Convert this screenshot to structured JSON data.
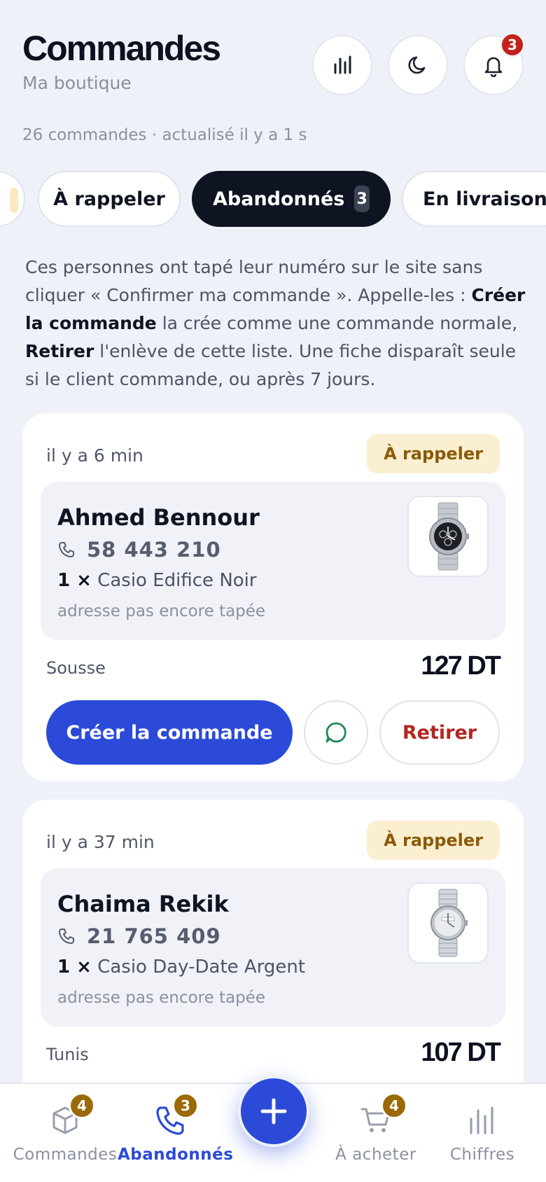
{
  "header": {
    "title": "Commandes",
    "subtitle": "Ma boutique",
    "notifications_count": "3",
    "meta": "26 commandes · actualisé il y a 1 s"
  },
  "filters": {
    "chips": [
      {
        "label": "À rappeler",
        "active": false
      },
      {
        "label": "Abandonnés",
        "count": "3",
        "active": true
      },
      {
        "label": "En livraison",
        "active": false
      }
    ]
  },
  "info": {
    "part1": "Ces personnes ont tapé leur numéro sur le site sans cliquer « Confirmer ma commande ». Appelle-les : ",
    "bold1": "Créer la commande",
    "part2": " la crée comme une commande normale, ",
    "bold2": "Retirer",
    "part3": " l'enlève de cette liste. Une fiche disparaît seule si le client commande, ou après 7 jours."
  },
  "cards": [
    {
      "time": "il y a 6 min",
      "status": "À rappeler",
      "name": "Ahmed Bennour",
      "phone": "58 443 210",
      "qty": "1 ×",
      "product": "Casio Edifice Noir",
      "address": "adresse pas encore tapée",
      "city": "Sousse",
      "price": "127 DT",
      "create_label": "Créer la commande",
      "remove_label": "Retirer",
      "thumb_dial": "#1d1f24"
    },
    {
      "time": "il y a 37 min",
      "status": "À rappeler",
      "name": "Chaima Rekik",
      "phone": "21 765 409",
      "qty": "1 ×",
      "product": "Casio Day-Date Argent",
      "address": "adresse pas encore tapée",
      "city": "Tunis",
      "price": "107 DT",
      "thumb_dial": "#e9ebef"
    }
  ],
  "bottom_nav": {
    "items": [
      {
        "label": "Commandes",
        "badge": "4"
      },
      {
        "label": "Abandonnés",
        "badge": "3"
      },
      {
        "label": "À acheter",
        "badge": "4"
      },
      {
        "label": "Chiffres"
      }
    ]
  },
  "colors": {
    "accent": "#2b4ad8",
    "danger": "#b22820",
    "warning_bg": "#fbefd2",
    "warning_fg": "#8a5a06",
    "badge_gold": "#9a6a09"
  },
  "icons": [
    "stats-icon",
    "moon-icon",
    "bell-icon",
    "phone-icon",
    "whatsapp-icon",
    "box-icon",
    "cart-icon",
    "plus-icon"
  ]
}
